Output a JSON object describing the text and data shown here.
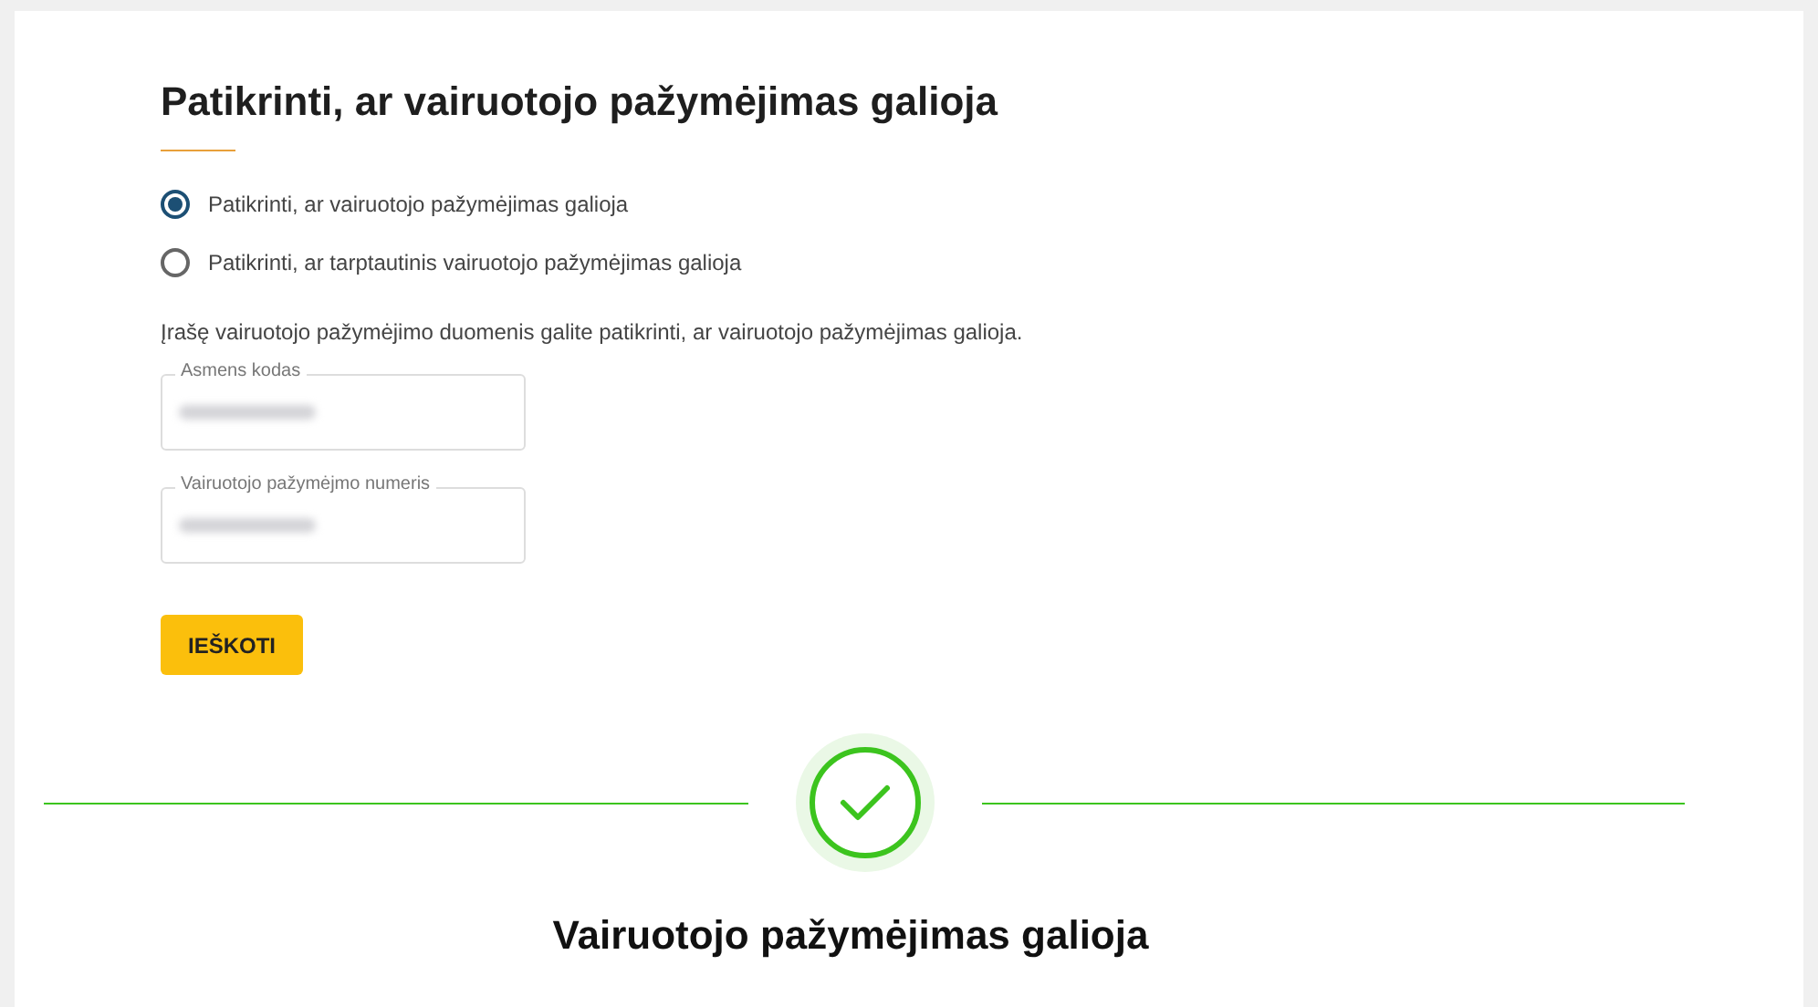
{
  "title": "Patikrinti, ar vairuotojo pažymėjimas galioja",
  "options": [
    {
      "label": "Patikrinti, ar vairuotojo pažymėjimas galioja",
      "selected": true
    },
    {
      "label": "Patikrinti, ar tarptautinis vairuotojo pažymėjimas galioja",
      "selected": false
    }
  ],
  "description": "Įrašę vairuotojo pažymėjimo duomenis galite patikrinti, ar vairuotojo pažymėjimas galioja.",
  "fields": [
    {
      "label": "Asmens kodas"
    },
    {
      "label": "Vairuotojo pažymėjmo numeris"
    }
  ],
  "button": "IEŠKOTI",
  "result": {
    "valid": true,
    "message": "Vairuotojo pažymėjimas galioja"
  }
}
